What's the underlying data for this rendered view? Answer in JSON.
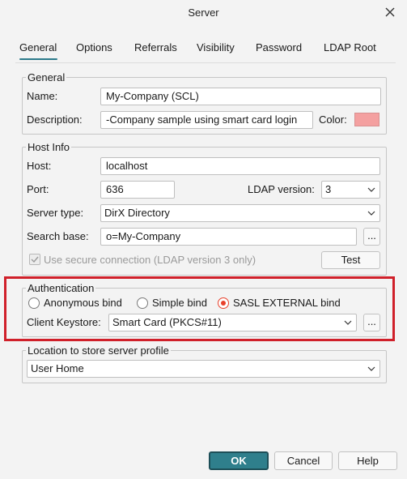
{
  "window": {
    "title": "Server"
  },
  "tabs": [
    {
      "label": "General"
    },
    {
      "label": "Options"
    },
    {
      "label": "Referrals"
    },
    {
      "label": "Visibility"
    },
    {
      "label": "Password"
    },
    {
      "label": "LDAP Root"
    }
  ],
  "general": {
    "legend": "General",
    "name_label": "Name:",
    "name_value": "My-Company (SCL)",
    "description_label": "Description:",
    "description_value": "-Company sample using smart card login",
    "color_label": "Color:",
    "color_value": "#f4a0a0"
  },
  "host_info": {
    "legend": "Host Info",
    "host_label": "Host:",
    "host_value": "localhost",
    "port_label": "Port:",
    "port_value": "636",
    "ldap_version_label": "LDAP version:",
    "ldap_version_value": "3",
    "server_type_label": "Server type:",
    "server_type_value": "DirX Directory",
    "search_base_label": "Search base:",
    "search_base_value": "o=My-Company",
    "browse_label": "...",
    "secure_label": "Use secure connection (LDAP version 3 only)",
    "test_label": "Test"
  },
  "authentication": {
    "legend": "Authentication",
    "options": [
      {
        "label": "Anonymous bind",
        "selected": false
      },
      {
        "label": "Simple bind",
        "selected": false
      },
      {
        "label": "SASL EXTERNAL bind",
        "selected": true
      }
    ],
    "keystore_label": "Client Keystore:",
    "keystore_value": "Smart Card (PKCS#11)",
    "browse_label": "..."
  },
  "location": {
    "legend": "Location to store server profile",
    "value": "User Home"
  },
  "buttons": {
    "ok": "OK",
    "cancel": "Cancel",
    "help": "Help"
  },
  "colors": {
    "accent": "#2c7a8a",
    "ok_fill": "#2f7f8c",
    "highlight": "#d0202a",
    "radio_selected": "#e8412c"
  }
}
